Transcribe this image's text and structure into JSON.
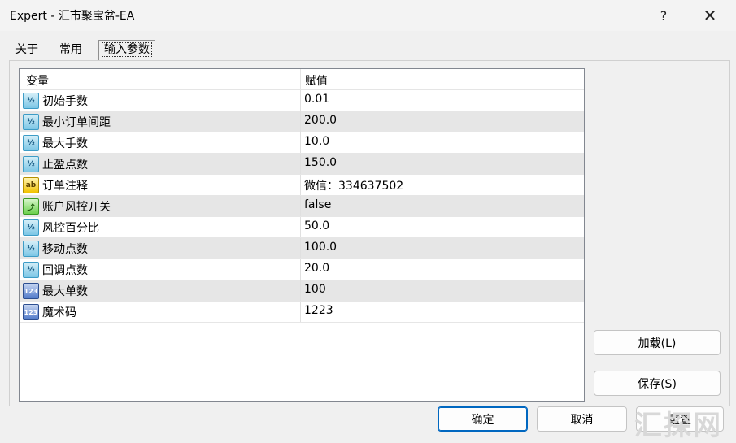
{
  "window": {
    "title": "Expert - 汇市聚宝盆-EA",
    "help": "?",
    "close": "✕"
  },
  "tabs": [
    {
      "label": "关于"
    },
    {
      "label": "常用"
    },
    {
      "label": "输入参数"
    }
  ],
  "grid": {
    "headers": {
      "variable": "变量",
      "value": "赋值"
    },
    "rows": [
      {
        "type": "double",
        "icon": "½",
        "name": "初始手数",
        "value": "0.01"
      },
      {
        "type": "double",
        "icon": "½",
        "name": "最小订单间距",
        "value": "200.0"
      },
      {
        "type": "double",
        "icon": "½",
        "name": "最大手数",
        "value": "10.0"
      },
      {
        "type": "double",
        "icon": "½",
        "name": "止盈点数",
        "value": "150.0"
      },
      {
        "type": "string",
        "icon": "ab",
        "name": "订单注释",
        "value": "微信：334637502"
      },
      {
        "type": "bool",
        "icon": "⤴",
        "name": "账户风控开关",
        "value": "false"
      },
      {
        "type": "double",
        "icon": "½",
        "name": "风控百分比",
        "value": "50.0"
      },
      {
        "type": "double",
        "icon": "½",
        "name": "移动点数",
        "value": "100.0"
      },
      {
        "type": "double",
        "icon": "½",
        "name": "回调点数",
        "value": "20.0"
      },
      {
        "type": "int",
        "icon": "123",
        "name": "最大单数",
        "value": "100"
      },
      {
        "type": "int",
        "icon": "123",
        "name": "魔术码",
        "value": "1223"
      }
    ]
  },
  "buttons": {
    "load": "加载(L)",
    "save": "保存(S)",
    "ok": "确定",
    "cancel": "取消",
    "reset": "重置"
  },
  "watermark": "汇探网"
}
